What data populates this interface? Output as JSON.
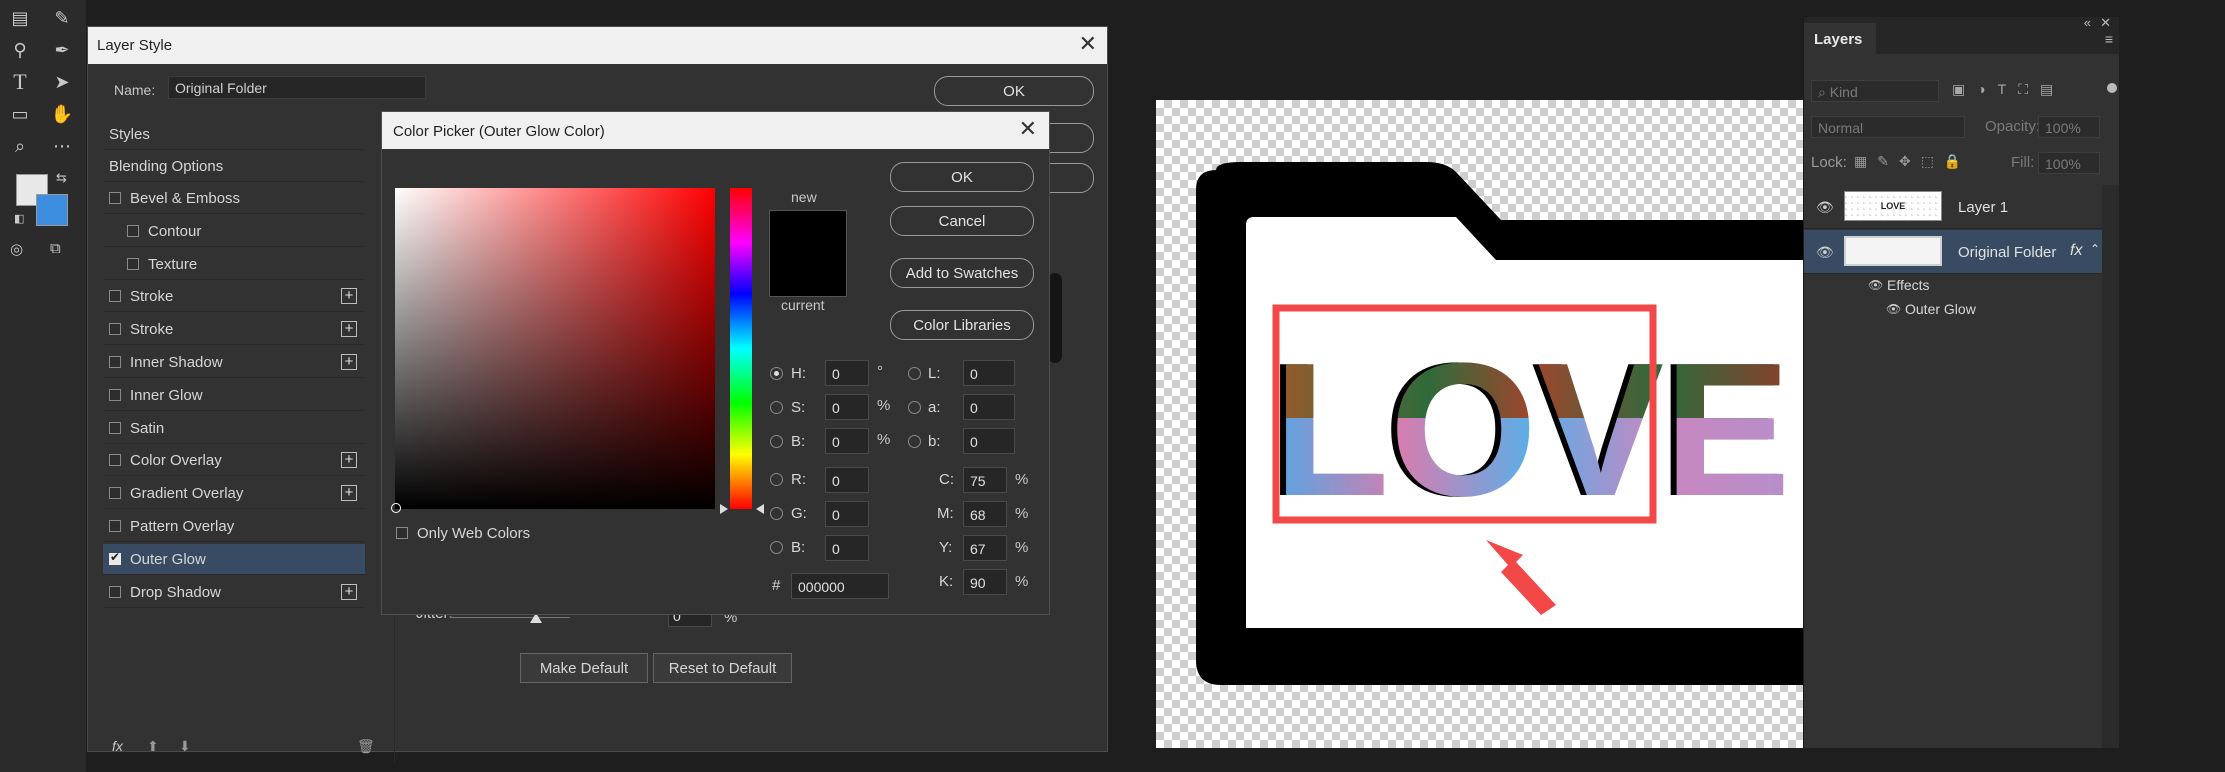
{
  "layer_style": {
    "title": "Layer Style",
    "name_label": "Name:",
    "name_value": "Original Folder",
    "ok_label": "OK",
    "styles_header": "Styles",
    "blending_options": "Blending Options",
    "items": [
      {
        "label": "Bevel & Emboss",
        "checked": false,
        "plus": false
      },
      {
        "label": "Contour",
        "checked": false,
        "plus": false
      },
      {
        "label": "Texture",
        "checked": false,
        "plus": false
      },
      {
        "label": "Stroke",
        "checked": false,
        "plus": true
      },
      {
        "label": "Stroke",
        "checked": false,
        "plus": true
      },
      {
        "label": "Inner Shadow",
        "checked": false,
        "plus": true
      },
      {
        "label": "Inner Glow",
        "checked": false,
        "plus": false
      },
      {
        "label": "Satin",
        "checked": false,
        "plus": false
      },
      {
        "label": "Color Overlay",
        "checked": false,
        "plus": true
      },
      {
        "label": "Gradient Overlay",
        "checked": false,
        "plus": true
      },
      {
        "label": "Pattern Overlay",
        "checked": false,
        "plus": false
      },
      {
        "label": "Outer Glow",
        "checked": true,
        "plus": false
      },
      {
        "label": "Drop Shadow",
        "checked": false,
        "plus": true
      }
    ],
    "jitter_label": "Jitter:",
    "jitter_value": "0",
    "jitter_unit": "%",
    "make_default": "Make Default",
    "reset_default": "Reset to Default",
    "fx_label": "fx"
  },
  "color_picker": {
    "title": "Color Picker (Outer Glow Color)",
    "ok": "OK",
    "cancel": "Cancel",
    "add_swatches": "Add to Swatches",
    "color_libraries": "Color Libraries",
    "new_label": "new",
    "current_label": "current",
    "only_web_colors": "Only Web Colors",
    "hsb": [
      {
        "label": "H:",
        "value": "0",
        "unit": "°",
        "selected": true
      },
      {
        "label": "S:",
        "value": "0",
        "unit": "%",
        "selected": false
      },
      {
        "label": "B:",
        "value": "0",
        "unit": "%",
        "selected": false
      }
    ],
    "rgb": [
      {
        "label": "R:",
        "value": "0"
      },
      {
        "label": "G:",
        "value": "0"
      },
      {
        "label": "B:",
        "value": "0"
      }
    ],
    "lab": [
      {
        "label": "L:",
        "value": "0"
      },
      {
        "label": "a:",
        "value": "0"
      },
      {
        "label": "b:",
        "value": "0"
      }
    ],
    "cmyk": [
      {
        "label": "C:",
        "value": "75",
        "unit": "%"
      },
      {
        "label": "M:",
        "value": "68",
        "unit": "%"
      },
      {
        "label": "Y:",
        "value": "67",
        "unit": "%"
      },
      {
        "label": "K:",
        "value": "90",
        "unit": "%"
      }
    ],
    "hex_label": "#",
    "hex_value": "000000",
    "current_color": "#000000"
  },
  "layers_panel": {
    "tab": "Layers",
    "kind_placeholder": "Kind",
    "blend_mode": "Normal",
    "opacity_label": "Opacity:",
    "opacity_value": "100%",
    "lock_label": "Lock:",
    "fill_label": "Fill:",
    "fill_value": "100%",
    "layers": [
      {
        "name": "Layer 1",
        "thumb_text": "LOVE",
        "selected": false
      },
      {
        "name": "Original Folder",
        "thumb_text": "",
        "selected": true,
        "fx": "fx"
      }
    ],
    "effects_label": "Effects",
    "effect_name": "Outer Glow"
  },
  "canvas": {
    "art_text": "LOVE"
  },
  "colors": {
    "accent_selected": "#394b62",
    "annotation_red": "#f24848"
  }
}
